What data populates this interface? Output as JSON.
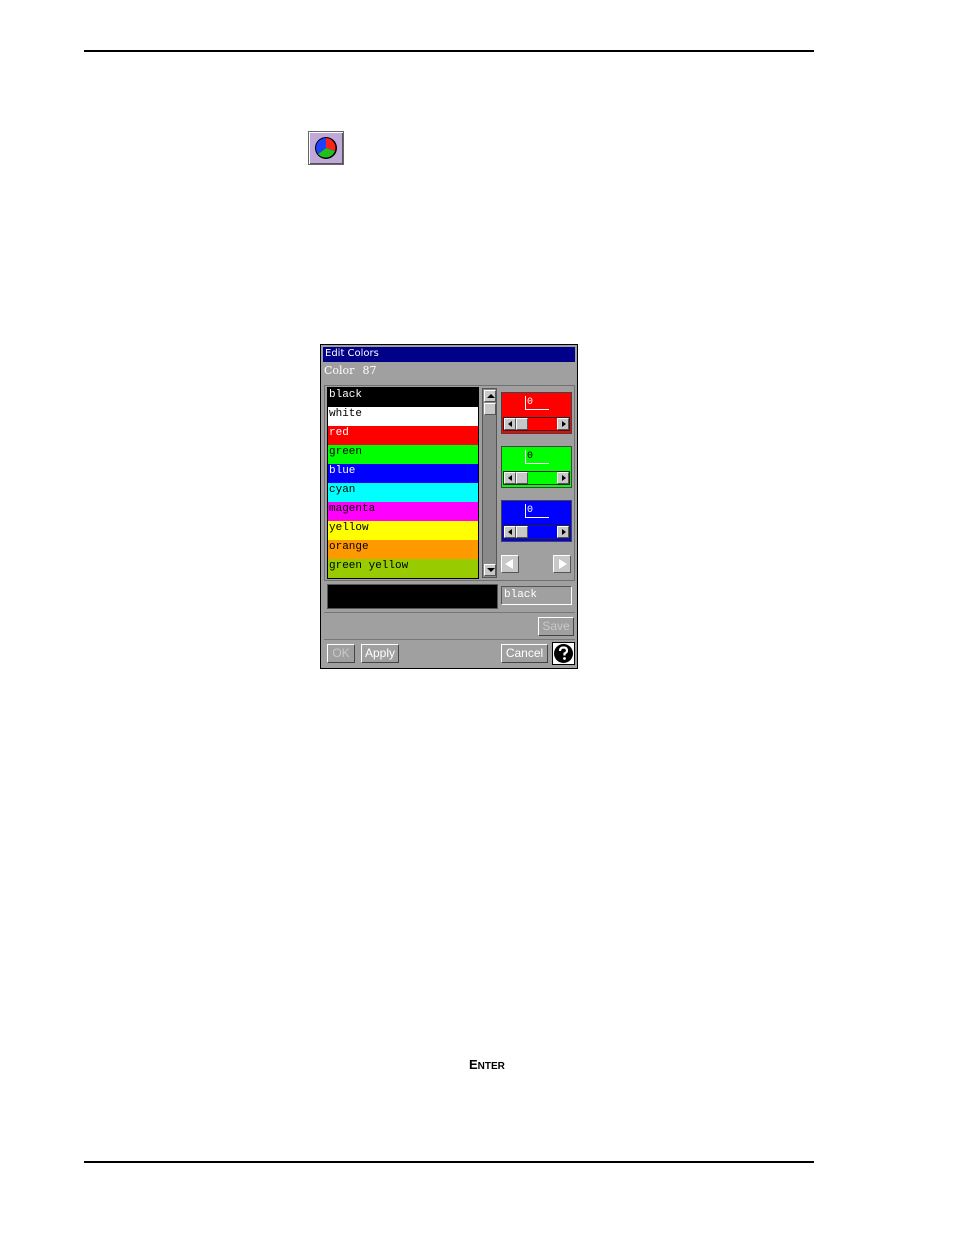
{
  "tool_icon": "color-wheel-icon",
  "dialog": {
    "title": "Edit Colors",
    "color_label": "Color",
    "color_number": "87",
    "list": [
      {
        "name": "black",
        "bg": "#000000",
        "fg": "#ffffff"
      },
      {
        "name": "white",
        "bg": "#ffffff",
        "fg": "#000000"
      },
      {
        "name": "red",
        "bg": "#ff0000",
        "fg": "#ffffff"
      },
      {
        "name": "green",
        "bg": "#00ff00",
        "fg": "#000000"
      },
      {
        "name": "blue",
        "bg": "#0000ff",
        "fg": "#ffffff"
      },
      {
        "name": "cyan",
        "bg": "#00ffff",
        "fg": "#000000"
      },
      {
        "name": "magenta",
        "bg": "#ff00ff",
        "fg": "#000000"
      },
      {
        "name": "yellow",
        "bg": "#ffff00",
        "fg": "#000000"
      },
      {
        "name": "orange",
        "bg": "#ff9900",
        "fg": "#000000"
      },
      {
        "name": "green yellow",
        "bg": "#99cc00",
        "fg": "#000000"
      }
    ],
    "channels": {
      "red": {
        "value": "0",
        "bg": "#ff0000"
      },
      "green": {
        "value": "0",
        "bg": "#00ff00"
      },
      "blue": {
        "value": "0",
        "bg": "#0000ff"
      }
    },
    "name_field_value": "black",
    "preview_color": "#000000",
    "buttons": {
      "save": "Save",
      "ok": "OK",
      "apply": "Apply",
      "cancel": "Cancel"
    },
    "help_icon": "help-icon"
  },
  "footer_key": {
    "first": "E",
    "rest": "NTER"
  }
}
